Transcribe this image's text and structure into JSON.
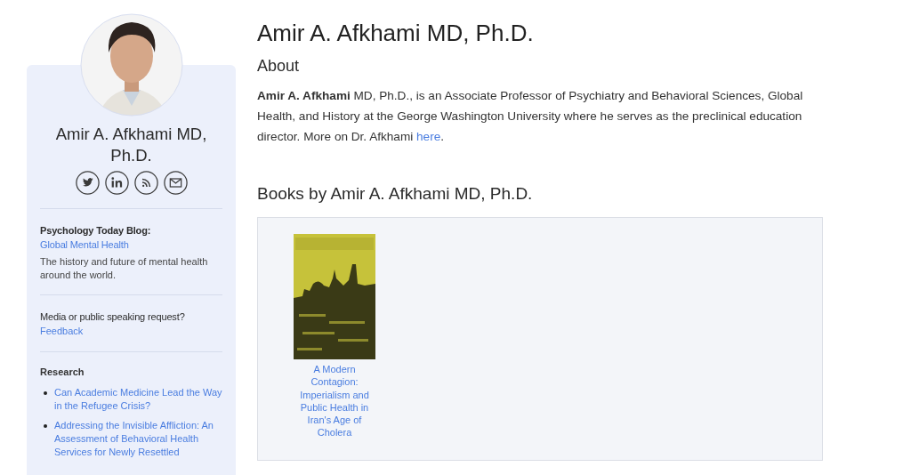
{
  "profile": {
    "name": "Amir A. Afkhami MD, Ph.D.",
    "social": [
      {
        "kind": "twitter"
      },
      {
        "kind": "linkedin"
      },
      {
        "kind": "rss"
      },
      {
        "kind": "email"
      }
    ]
  },
  "blog": {
    "label": "Psychology Today Blog:",
    "link": "Global Mental Health",
    "description": "The history and future of mental health around the world."
  },
  "media": {
    "label": "Media or public speaking request?",
    "link": "Feedback"
  },
  "research": {
    "heading": "Research",
    "items": [
      "Can Academic Medicine Lead the Way in the Refugee Crisis?",
      "Addressing the Invisible Affliction: An Assessment of Behavioral Health Services for Newly Resettled"
    ]
  },
  "title": "Amir A. Afkhami MD, Ph.D.",
  "about": {
    "heading": "About",
    "text": "**Amir A. Afkhami** MD, Ph.D., is an Associate Professor of Psychiatry and Behavioral Sciences, Global Health, and History at the George Washington University where he serves as the preclinical education director. More on Dr. Afkhami ",
    "link": "here",
    "after": "."
  },
  "books": {
    "heading": "Books by Amir A. Afkhami MD, Ph.D.",
    "items": [
      {
        "title": "A Modern Contagion: Imperialism and Public Health in Iran's Age of Cholera"
      }
    ]
  }
}
